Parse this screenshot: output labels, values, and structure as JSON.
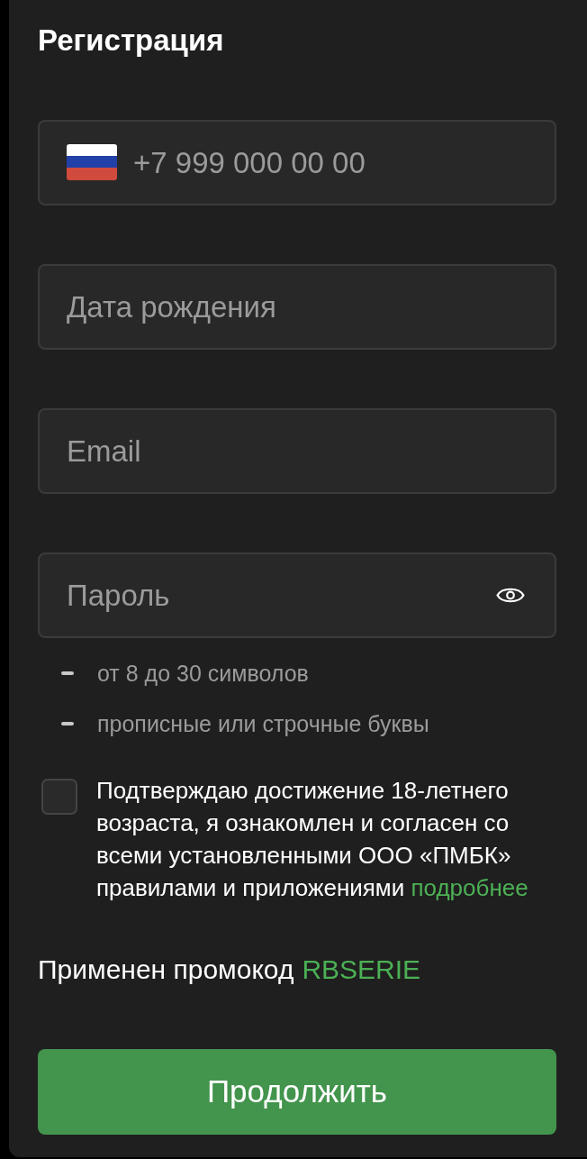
{
  "title": "Регистрация",
  "fields": [
    {
      "kind": "phone",
      "placeholder": "+7 999 000 00 00"
    },
    {
      "kind": "text",
      "placeholder": "Дата рождения"
    },
    {
      "kind": "text",
      "placeholder": "Email"
    },
    {
      "kind": "password",
      "placeholder": "Пароль"
    }
  ],
  "password_rules": [
    "от 8 до 30 символов",
    "прописные или строчные буквы"
  ],
  "consent": {
    "checked": false,
    "text": "Подтверждаю достижение 18-летнего возраста, я ознакомлен и согласен со всеми установленными ООО «ПМБК» правилами и приложениями",
    "link": "подробнее"
  },
  "promo": {
    "label": "Применен промокод",
    "code": "RBSERIE"
  },
  "submit": {
    "label": "Продолжить"
  }
}
